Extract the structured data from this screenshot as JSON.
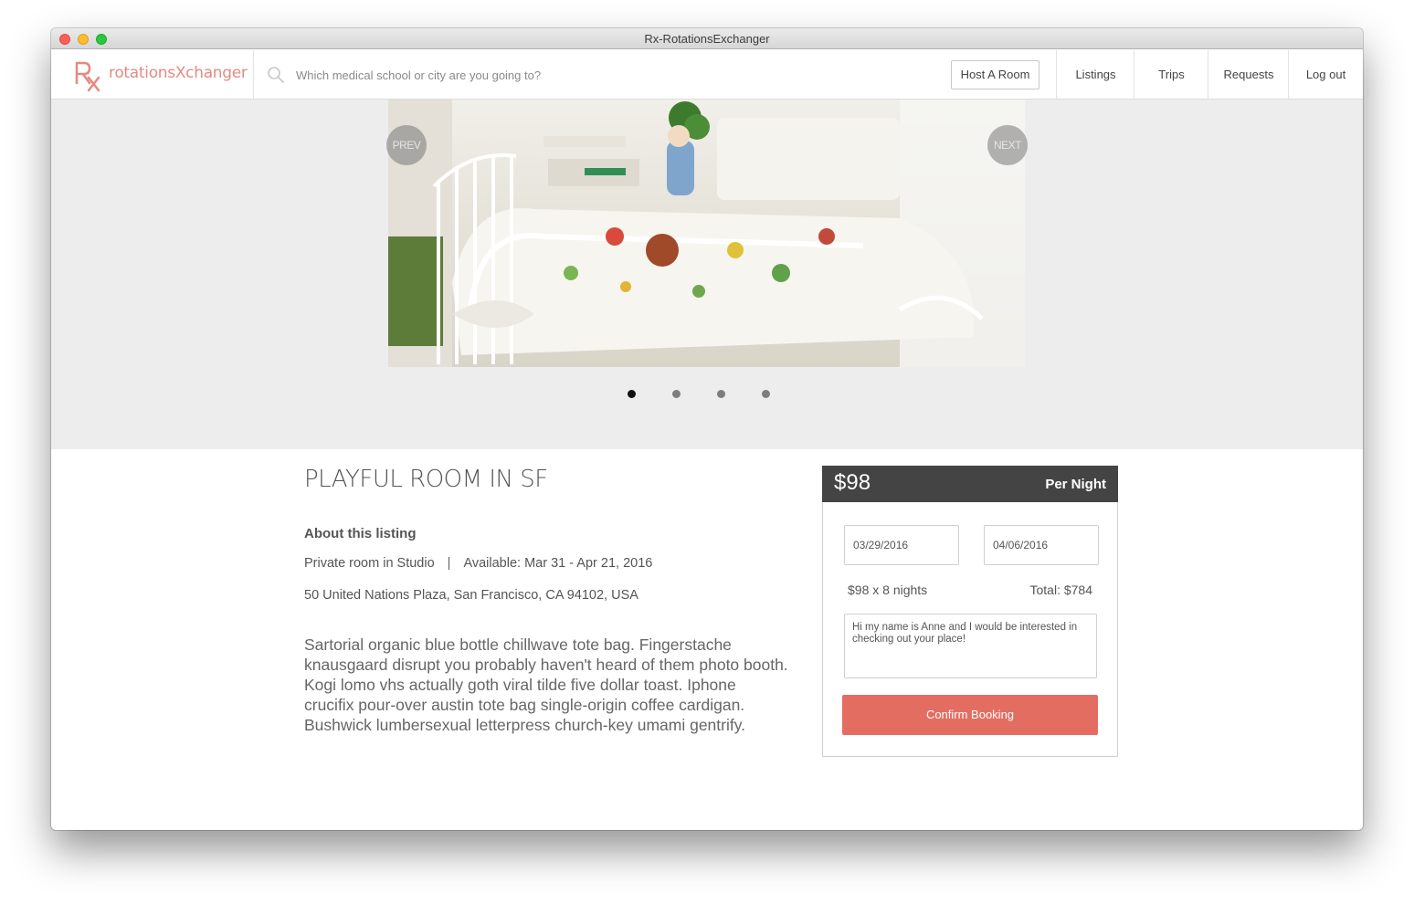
{
  "window": {
    "title": "Rx-RotationsExchanger"
  },
  "navbar": {
    "logo_mark": "Rx",
    "logo_text": "rotationsXchanger",
    "search_placeholder": "Which medical school or city are you going to?",
    "host_button": "Host A Room",
    "items": [
      {
        "label": "Listings"
      },
      {
        "label": "Trips"
      },
      {
        "label": "Requests"
      },
      {
        "label": "Log out"
      }
    ]
  },
  "gallery": {
    "prev_label": "PREV",
    "next_label": "NEXT",
    "slide_count": 4,
    "active_slide": 1
  },
  "listing": {
    "title": "PLAYFUL ROOM IN SF",
    "about_heading": "About this listing",
    "room_type": "Private room in Studio",
    "separator": "|",
    "availability": "Available: Mar 31 - Apr 21, 2016",
    "address": "50 United Nations Plaza, San Francisco, CA 94102, USA",
    "description": "Sartorial organic blue bottle chillwave tote bag. Fingerstache knausgaard disrupt you probably haven't heard of them photo booth. Kogi lomo vhs actually goth viral tilde five dollar toast. Iphone crucifix pour-over austin tote bag single-origin coffee cardigan. Bushwick lumbersexual letterpress church-key umami gentrify."
  },
  "booking": {
    "price": "$98",
    "per_night": "Per Night",
    "check_in": "03/29/2016",
    "check_out": "04/06/2016",
    "nights_calc": "$98 x 8 nights",
    "total": "Total: $784",
    "message": "Hi my name is Anne and I would be interested in checking out your place!",
    "confirm_label": "Confirm Booking"
  },
  "colors": {
    "brand": "#e58a80",
    "confirm_button": "#e46d62",
    "price_header": "#444444",
    "gallery_bg": "#ededed"
  }
}
